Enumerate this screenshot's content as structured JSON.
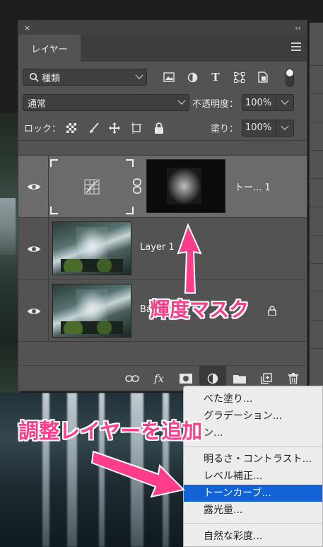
{
  "panel": {
    "close_glyph": "×",
    "collapse_glyph": "‹‹",
    "tab_label": "レイヤー",
    "filter": {
      "icon": "search-icon",
      "value": "種類"
    },
    "blend_mode": "通常",
    "opacity_label": "不透明度：",
    "opacity_value": "100%",
    "lock_label": "ロック：",
    "fill_label": "塗り：",
    "fill_value": "100%"
  },
  "layers": [
    {
      "name": "トー... 1",
      "type": "adjustment-curves",
      "selected": true,
      "visible": true
    },
    {
      "name": "Layer 1",
      "type": "photo",
      "selected": false,
      "visible": true
    },
    {
      "name": "Ba",
      "type": "photo",
      "locked": true,
      "selected": false,
      "visible": true
    }
  ],
  "bottom_bar": {
    "fx_label": "fx"
  },
  "context_menu": {
    "items": [
      {
        "label": "べた塗り..."
      },
      {
        "label": "グラデーション..."
      },
      {
        "label": "ン..."
      },
      {
        "separator": true
      },
      {
        "label": "明るさ・コントラスト..."
      },
      {
        "label": "レベル補正..."
      },
      {
        "label": "トーンカーブ...",
        "highlighted": true
      },
      {
        "label": "露光量..."
      },
      {
        "separator": true
      },
      {
        "label": "自然な彩度..."
      }
    ],
    "highlight_color": "#1463d6"
  },
  "annotations": {
    "luminance_mask": "輝度マスク",
    "add_adjustment_layer": "調整レイヤーを追加",
    "color": "#ff3d8a"
  }
}
